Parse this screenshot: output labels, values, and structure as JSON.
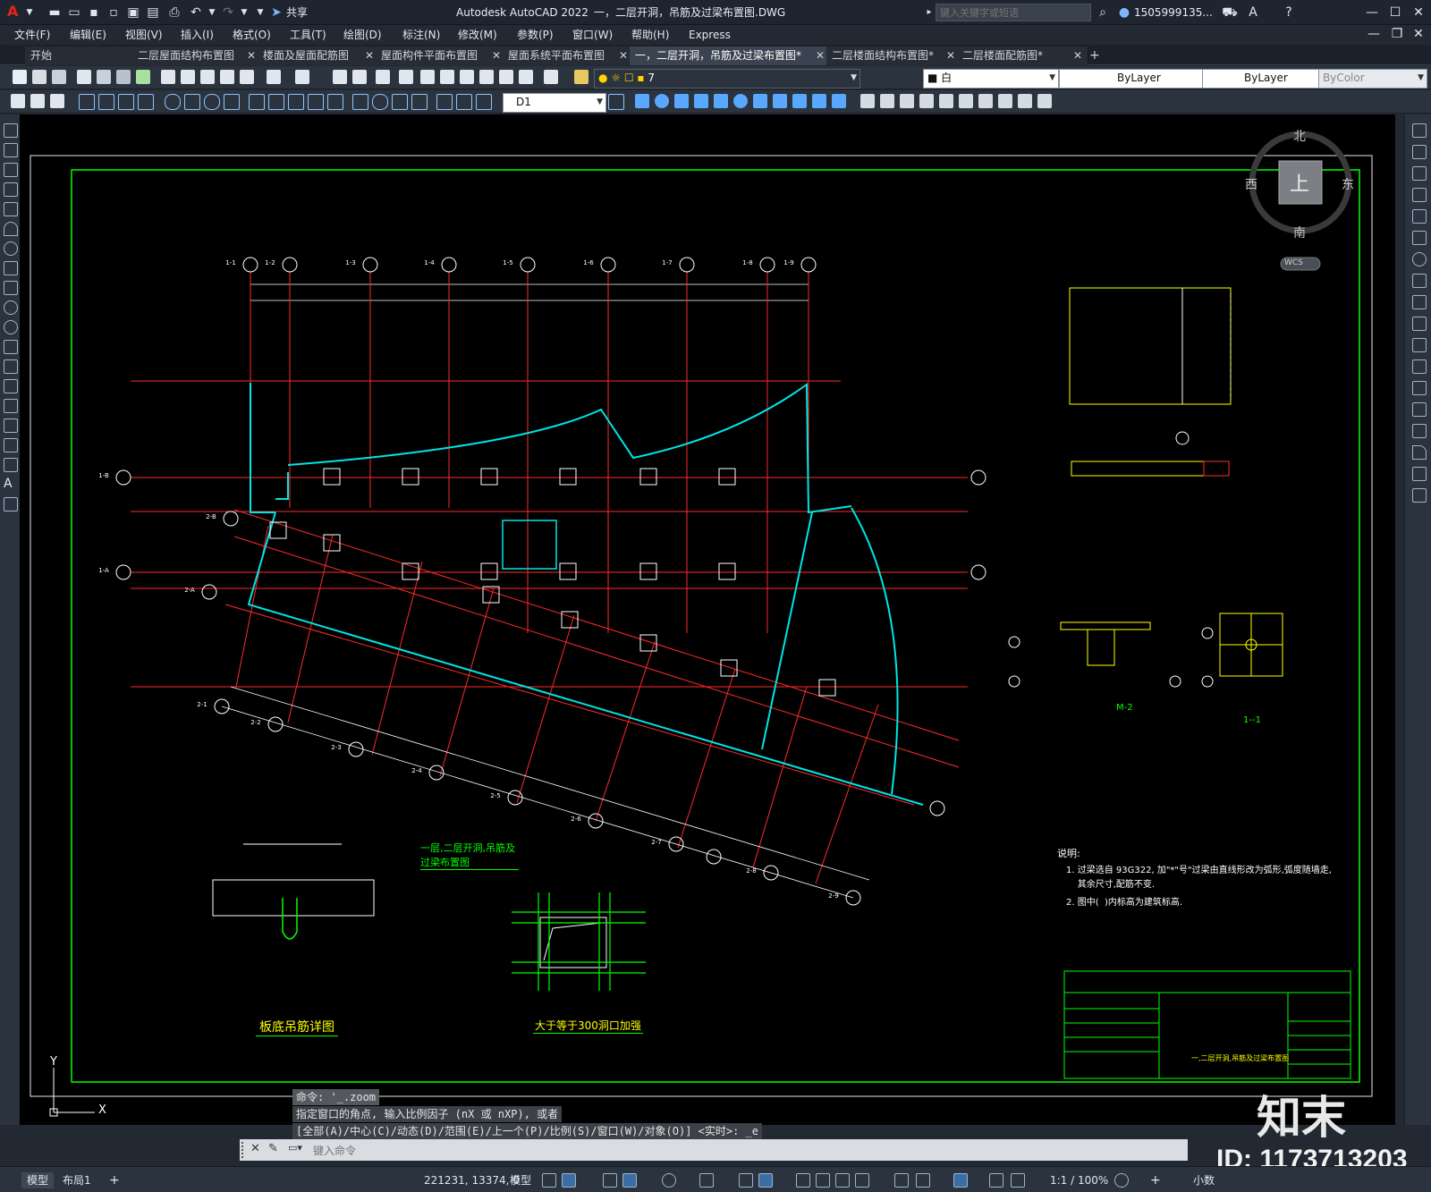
{
  "app": {
    "logo": "A",
    "title": "Autodesk AutoCAD 2022",
    "document": "一，二层开洞，吊筋及过梁布置图.DWG",
    "search_placeholder": "键入关键字或短语",
    "user": "1505999135...",
    "share_label": "共享"
  },
  "menu": [
    "文件(F)",
    "编辑(E)",
    "视图(V)",
    "插入(I)",
    "格式(O)",
    "工具(T)",
    "绘图(D)",
    "标注(N)",
    "修改(M)",
    "参数(P)",
    "窗口(W)",
    "帮助(H)",
    "Express"
  ],
  "tabs": [
    {
      "label": "开始"
    },
    {
      "label": "二层屋面结构布置图"
    },
    {
      "label": "楼面及屋面配筋图"
    },
    {
      "label": "屋面构件平面布置图"
    },
    {
      "label": "屋面系统平面布置图"
    },
    {
      "label": "一，二层开洞，吊筋及过梁布置图*"
    },
    {
      "label": "二层楼面结构布置图*"
    },
    {
      "label": "二层楼面配筋图*"
    }
  ],
  "properties": {
    "layer_value": "7",
    "color_value": "白",
    "linetype_value": "ByLayer",
    "lineweight_value": "ByLayer",
    "plotstyle_value": "ByColor",
    "dimstyle_value": "D1"
  },
  "viewcube": {
    "north": "北",
    "south": "南",
    "east": "东",
    "west": "西",
    "top": "上",
    "wcs": "WCS"
  },
  "drawing": {
    "axis_labels_top": [
      "1-1",
      "1-2",
      "1-3",
      "1-4",
      "1-5",
      "1-6",
      "1-7",
      "1-8",
      "1-9"
    ],
    "axis_labels_left": [
      "1-B",
      "2-B",
      "1-A",
      "2-A"
    ],
    "axis_labels_bottom": [
      "2-1",
      "2-2",
      "2-3",
      "2-4",
      "2-5",
      "2-6",
      "2-7",
      "2-8",
      "2-9"
    ],
    "main_title": "一层,二层开洞,吊筋及过梁布置图",
    "detail1_title": "板底吊筋详图",
    "detail2_title": "大于等于300洞口加强",
    "detail_m2": "M-2",
    "detail_section": "1--1",
    "note_title": "说明:",
    "note_lines": [
      "1. 过梁选自 93G322, 加\"*\"号\"过梁由直线形改为弧形,弧度随墙走,",
      "    其余尺寸,配筋不变.",
      "2. 图中(  )内标高为建筑标高."
    ],
    "titleblock_name": "一,二层开洞,吊筋及过梁布置图"
  },
  "command": {
    "history": [
      "命令: '_.zoom",
      "指定窗口的角点, 输入比例因子 (nX 或 nXP), 或者",
      "[全部(A)/中心(C)/动态(D)/范围(E)/上一个(P)/比例(S)/窗口(W)/对象(O)] <实时>: _e"
    ],
    "placeholder": "键入命令"
  },
  "status": {
    "model_tab": "模型",
    "layout_tab": "布局1",
    "coords": "221231, 13374, 0",
    "space": "模型",
    "scale": "1:1 / 100%",
    "units": "小数"
  },
  "watermark": {
    "brand": "知末",
    "id": "ID: 1173713203"
  }
}
